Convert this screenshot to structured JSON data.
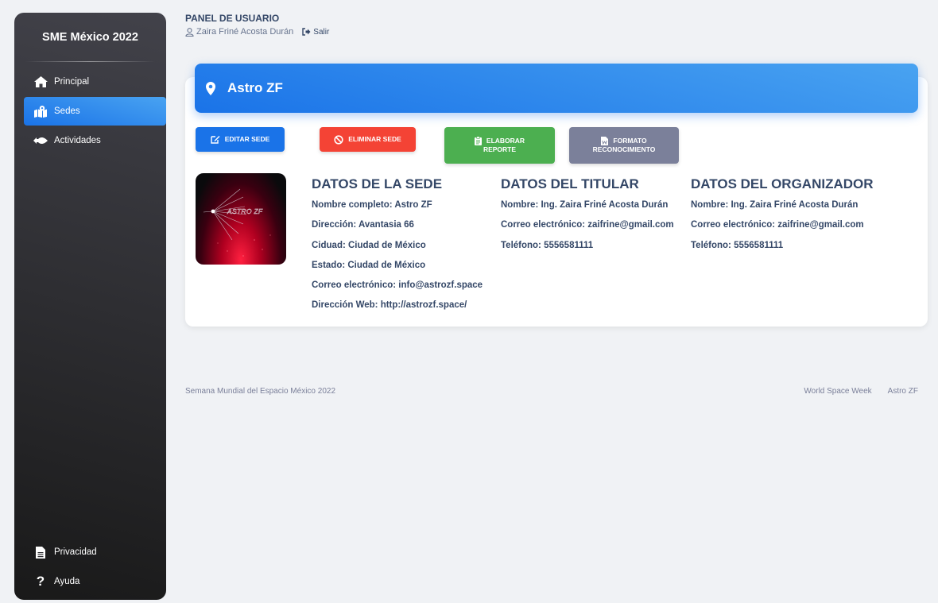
{
  "sidebar": {
    "brand": "SME México 2022",
    "items": [
      {
        "label": "Principal",
        "icon": "home-icon"
      },
      {
        "label": "Sedes",
        "icon": "map-icon",
        "active": true
      },
      {
        "label": "Actividades",
        "icon": "rocket-icon"
      }
    ],
    "bottom_items": [
      {
        "label": "Privacidad",
        "icon": "document-icon"
      },
      {
        "label": "Ayuda",
        "icon": "question-icon"
      }
    ]
  },
  "header": {
    "title": "PANEL DE USUARIO",
    "user": "Zaira Friné Acosta Durán",
    "logout": "Salir"
  },
  "venue": {
    "name": "Astro ZF",
    "logo_text": "ASTRO ZF",
    "actions": {
      "edit": "EDITAR SEDE",
      "delete": "ELIMINAR SEDE",
      "report_line1": "ELABORAR",
      "report_line2": "REPORTE",
      "format_line1": "FORMATO",
      "format_line2": "RECONOCIMIENTO"
    },
    "sede": {
      "title": "DATOS DE LA SEDE",
      "lines": [
        "Nombre completo: Astro ZF",
        "Dirección: Avantasia 66",
        "Ciduad: Ciudad de México",
        "Estado: Ciudad de México",
        "Correo electrónico: info@astrozf.space",
        "Dirección Web: http://astrozf.space/"
      ]
    },
    "titular": {
      "title": "DATOS DEL TITULAR",
      "lines": [
        "Nombre: Ing. Zaira Friné Acosta Durán",
        "Correo electrónico: zaifrine@gmail.com",
        "Teléfono: 5556581111"
      ]
    },
    "organizador": {
      "title": "DATOS DEL ORGANIZADOR",
      "lines": [
        "Nombre: Ing. Zaira Friné Acosta Durán",
        "Correo electrónico: zaifrine@gmail.com",
        "Teléfono: 5556581111"
      ]
    }
  },
  "footer": {
    "left": "Semana Mundial del Espacio México 2022",
    "links": [
      "World Space Week",
      "Astro ZF"
    ]
  },
  "colors": {
    "primary": "#1a73e8",
    "danger": "#f44335",
    "success": "#4caf50",
    "secondary": "#7b809a",
    "sidebar_dark": "#191919",
    "text": "#344767"
  }
}
